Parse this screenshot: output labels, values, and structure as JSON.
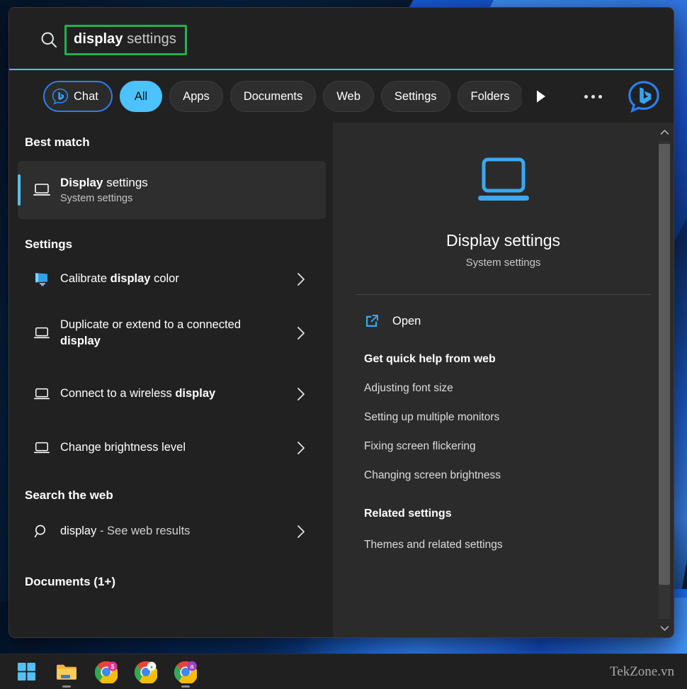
{
  "search": {
    "query_bold": "display",
    "query_rest": " settings",
    "query_full": "display settings",
    "icon": "search-icon",
    "highlight_color": "#22b14c"
  },
  "filters": {
    "items": [
      {
        "label": "Chat",
        "icon": "bing-chat-icon",
        "style": "outlined"
      },
      {
        "label": "All",
        "style": "selected"
      },
      {
        "label": "Apps",
        "style": "normal"
      },
      {
        "label": "Documents",
        "style": "normal"
      },
      {
        "label": "Web",
        "style": "normal"
      },
      {
        "label": "Settings",
        "style": "normal"
      },
      {
        "label": "Folders",
        "style": "clipped"
      }
    ],
    "scroll_next_icon": "play-right-icon",
    "more_label": "...",
    "more_icon": "ellipsis-icon",
    "bing_logo_icon": "bing-logo-icon"
  },
  "results": {
    "best_match_heading": "Best match",
    "best_match": {
      "title_bold": "Display",
      "title_rest": " settings",
      "subtitle": "System settings",
      "icon": "laptop-icon"
    },
    "settings_heading": "Settings",
    "settings_items": [
      {
        "pre": "Calibrate ",
        "bold": "display",
        "post": " color",
        "icon": "monitor-color-icon"
      },
      {
        "pre": "Duplicate or extend to a connected ",
        "bold": "display",
        "post": "",
        "icon": "laptop-icon"
      },
      {
        "pre": "Connect to a wireless ",
        "bold": "display",
        "post": "",
        "icon": "laptop-icon"
      },
      {
        "pre": "Change brightness level",
        "bold": "",
        "post": "",
        "icon": "laptop-icon"
      }
    ],
    "web_heading": "Search the web",
    "web_item": {
      "pre": "display",
      "post": " - See web results",
      "icon": "search-icon"
    },
    "documents_heading": "Documents (1+)"
  },
  "preview": {
    "hero_icon": "laptop-large-icon",
    "title": "Display settings",
    "subtitle": "System settings",
    "open_label": "Open",
    "open_icon": "open-external-icon",
    "quick_help_heading": "Get quick help from web",
    "quick_help_links": [
      "Adjusting font size",
      "Setting up multiple monitors",
      "Fixing screen flickering",
      "Changing screen brightness"
    ],
    "related_heading": "Related settings",
    "related_links": [
      "Themes and related settings"
    ],
    "scroll_up_icon": "chevron-up-icon",
    "scroll_down_icon": "chevron-down-icon"
  },
  "taskbar": {
    "items": [
      {
        "name": "start",
        "icon": "windows-start-icon",
        "running": false
      },
      {
        "name": "file-explorer",
        "icon": "folder-icon",
        "running": true
      },
      {
        "name": "chrome-1",
        "icon": "chrome-icon",
        "badge": "$",
        "running": false
      },
      {
        "name": "chrome-2",
        "icon": "chrome-icon",
        "badge": "",
        "running": false
      },
      {
        "name": "chrome-3",
        "icon": "chrome-icon",
        "badge": "a",
        "running": true
      }
    ],
    "watermark": "TekZone.vn"
  },
  "theme": {
    "accent": "#4cc2ff",
    "panel_bg": "#212121",
    "preview_bg": "#2b2b2b",
    "chat_border": "#2b7ff0"
  }
}
